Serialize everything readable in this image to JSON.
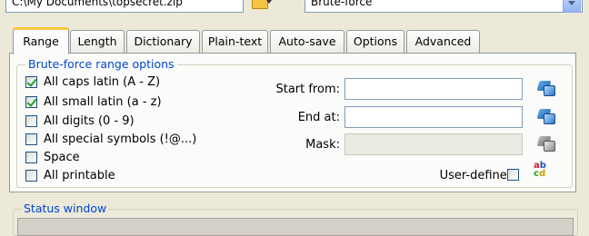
{
  "file_path": "C:\\My Documents\\topsecret.zip",
  "attack_type": "Brute-force",
  "tabs": [
    {
      "label": "Range",
      "active": true
    },
    {
      "label": "Length"
    },
    {
      "label": "Dictionary"
    },
    {
      "label": "Plain-text"
    },
    {
      "label": "Auto-save"
    },
    {
      "label": "Options"
    },
    {
      "label": "Advanced"
    }
  ],
  "range_group": {
    "title": "Brute-force range options",
    "checkboxes": [
      {
        "label": "All caps latin (A - Z)",
        "checked": true
      },
      {
        "label": "All small latin (a - z)",
        "checked": true
      },
      {
        "label": "All digits (0 - 9)",
        "checked": false
      },
      {
        "label": "All special symbols (!@...)",
        "checked": false
      },
      {
        "label": "Space",
        "checked": false
      },
      {
        "label": "All printable",
        "checked": false
      }
    ],
    "start_from_label": "Start from:",
    "start_from_value": "",
    "end_at_label": "End at:",
    "end_at_value": "",
    "mask_label": "Mask:",
    "mask_value": "",
    "user_defined_label": "User-defined",
    "user_defined_checked": false
  },
  "status_window": {
    "title": "Status window"
  },
  "icons": {
    "open_file": "folder-open-icon",
    "set_start": "select-chars-icon",
    "set_end": "select-chars-icon",
    "set_mask": "select-chars-icon",
    "charset": "abc-charset-icon"
  }
}
